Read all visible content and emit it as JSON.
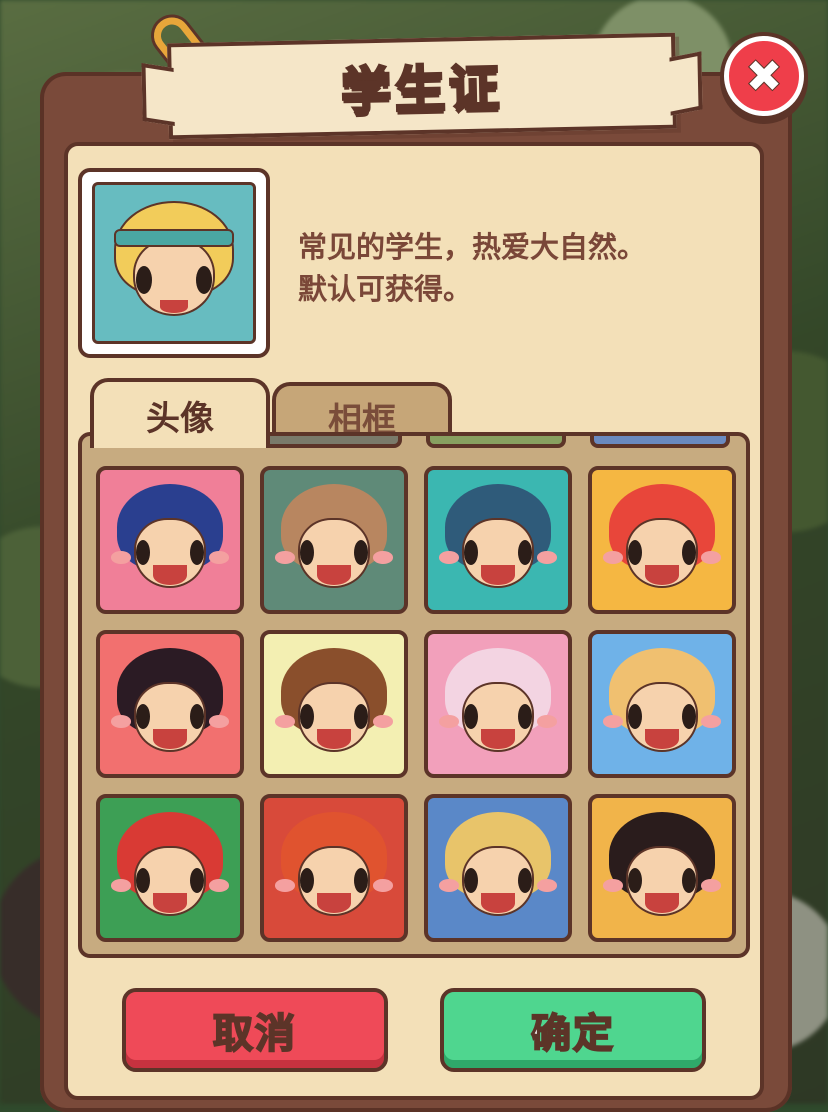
{
  "dialog": {
    "title": "学生证",
    "close_icon": "close-icon"
  },
  "featured": {
    "description_line1": "常见的学生，热爱大自然。",
    "description_line2": "默认可获得。"
  },
  "tabs": [
    {
      "label": "头像",
      "active": true
    },
    {
      "label": "相框",
      "active": false
    }
  ],
  "avatars": [
    {
      "name": "avatar-blue-hair-hedgehog",
      "bg": "#f07f98",
      "hair": "#2a3f8f"
    },
    {
      "name": "avatar-bald-sunglasses",
      "bg": "#5f8a78",
      "hair": "#b88660"
    },
    {
      "name": "avatar-snowman-cap",
      "bg": "#3bb7b1",
      "hair": "#2f5b7a"
    },
    {
      "name": "avatar-red-lion-dance",
      "bg": "#f5b742",
      "hair": "#e8463a"
    },
    {
      "name": "avatar-black-buns-girl",
      "bg": "#f2706f",
      "hair": "#2b1b24"
    },
    {
      "name": "avatar-bride-tiara",
      "bg": "#f3efb2",
      "hair": "#8a4f2c"
    },
    {
      "name": "avatar-pink-strawberry-girl",
      "bg": "#f2a0bb",
      "hair": "#f3d4e2"
    },
    {
      "name": "avatar-white-veil-bride",
      "bg": "#6fb2e8",
      "hair": "#f0c070"
    },
    {
      "name": "avatar-reindeer-santa",
      "bg": "#3d9f55",
      "hair": "#d93a34"
    },
    {
      "name": "avatar-red-lion-costume",
      "bg": "#d84a3a",
      "hair": "#e0532f"
    },
    {
      "name": "avatar-blonde-alice",
      "bg": "#5a88c8",
      "hair": "#e8c46a"
    },
    {
      "name": "avatar-black-hair-hanfu",
      "bg": "#f1b44a",
      "hair": "#2a1c1c"
    }
  ],
  "buttons": {
    "cancel": "取消",
    "confirm": "确定"
  }
}
